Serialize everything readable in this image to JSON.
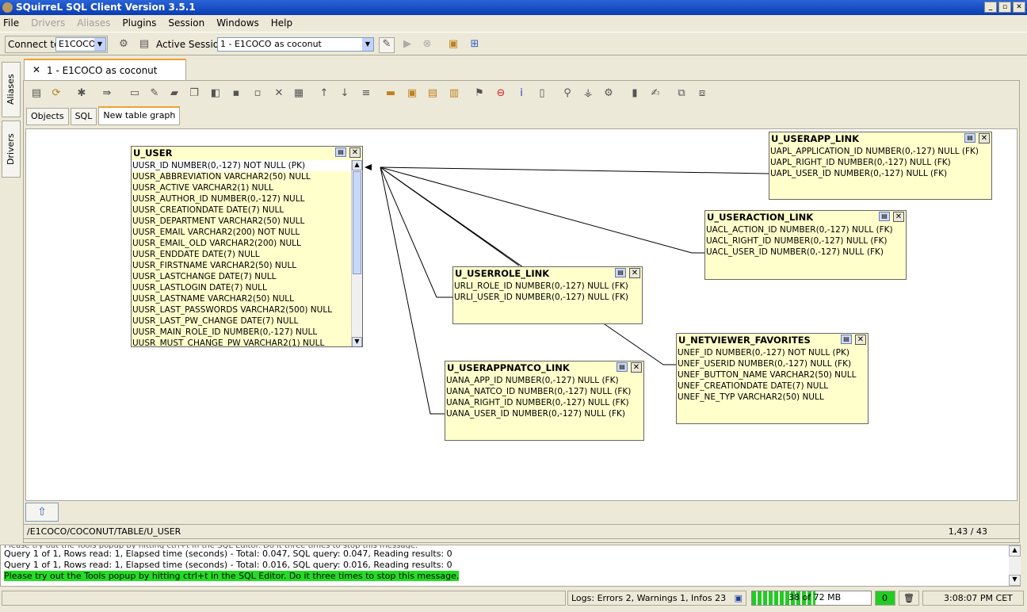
{
  "window": {
    "title": "SQuirreL SQL Client Version 3.5.1"
  },
  "menu": [
    "File",
    "Drivers",
    "Aliases",
    "Plugins",
    "Session",
    "Windows",
    "Help"
  ],
  "menu_disabled": [
    "Drivers",
    "Aliases"
  ],
  "toolbar": {
    "connect_label": "Connect to:",
    "connect_value": "E1COCO",
    "active_session_label": "Active Session:",
    "active_session_value": "1 - E1COCO as coconut"
  },
  "side_tabs": [
    "Aliases",
    "Drivers"
  ],
  "session_tab": {
    "label": "1 - E1COCO as coconut"
  },
  "sub_tabs": [
    "Objects",
    "SQL",
    "New table graph"
  ],
  "graph": {
    "tables": [
      {
        "name": "U_USER",
        "columns": [
          "UUSR_ID  NUMBER(0,-127) NOT NULL (PK)",
          "UUSR_ABBREVIATION  VARCHAR2(50) NULL",
          "UUSR_ACTIVE  VARCHAR2(1) NULL",
          "UUSR_AUTHOR_ID  NUMBER(0,-127) NULL",
          "UUSR_CREATIONDATE  DATE(7) NULL",
          "UUSR_DEPARTMENT  VARCHAR2(50) NULL",
          "UUSR_EMAIL  VARCHAR2(200) NOT NULL",
          "UUSR_EMAIL_OLD  VARCHAR2(200) NULL",
          "UUSR_ENDDATE  DATE(7) NULL",
          "UUSR_FIRSTNAME  VARCHAR2(50) NULL",
          "UUSR_LASTCHANGE  DATE(7) NULL",
          "UUSR_LASTLOGIN  DATE(7) NULL",
          "UUSR_LASTNAME  VARCHAR2(50) NULL",
          "UUSR_LAST_PASSWORDS  VARCHAR2(500) NULL",
          "UUSR_LAST_PW_CHANGE  DATE(7) NULL",
          "UUSR_MAIN_ROLE_ID  NUMBER(0,-127) NULL",
          "UUSR_MUST_CHANGE_PW  VARCHAR2(1) NULL"
        ]
      },
      {
        "name": "U_USERAPP_LINK",
        "columns": [
          "UAPL_APPLICATION_ID  NUMBER(0,-127) NULL (FK)",
          "UAPL_RIGHT_ID  NUMBER(0,-127) NULL (FK)",
          "UAPL_USER_ID  NUMBER(0,-127) NULL (FK)"
        ]
      },
      {
        "name": "U_USERACTION_LINK",
        "columns": [
          "UACL_ACTION_ID  NUMBER(0,-127) NULL (FK)",
          "UACL_RIGHT_ID  NUMBER(0,-127) NULL (FK)",
          "UACL_USER_ID  NUMBER(0,-127) NULL (FK)"
        ]
      },
      {
        "name": "U_USERROLE_LINK",
        "columns": [
          "URLI_ROLE_ID  NUMBER(0,-127) NULL (FK)",
          "URLI_USER_ID  NUMBER(0,-127) NULL (FK)"
        ]
      },
      {
        "name": "U_NETVIEWER_FAVORITES",
        "columns": [
          "UNEF_ID  NUMBER(0,-127) NOT NULL (PK)",
          "UNEF_USERID  NUMBER(0,-127) NULL (FK)",
          "UNEF_BUTTON_NAME  VARCHAR2(50) NULL",
          "UNEF_CREATIONDATE  DATE(7) NULL",
          "UNEF_NE_TYP  VARCHAR2(50) NULL"
        ]
      },
      {
        "name": "U_USERAPPNATCO_LINK",
        "columns": [
          "UANA_APP_ID  NUMBER(0,-127) NULL (FK)",
          "UANA_NATCO_ID  NUMBER(0,-127) NULL (FK)",
          "UANA_RIGHT_ID  NUMBER(0,-127) NULL (FK)",
          "UANA_USER_ID  NUMBER(0,-127) NULL (FK)"
        ]
      }
    ]
  },
  "path_bar": {
    "path": "/E1COCO/COCONUT/TABLE/U_USER",
    "position": "1,43 / 43"
  },
  "log": {
    "lines": [
      "Please try out the Tools popup by hitting ctrl+t in the SQL Editor. Do it three times to stop this message.",
      "Query 1 of 1, Rows read: 1, Elapsed time (seconds) - Total: 0.047, SQL query: 0.047, Reading results: 0",
      "Query 1 of 1, Rows read: 1, Elapsed time (seconds) - Total: 0.016, SQL query: 0.016, Reading results: 0"
    ],
    "highlight": "Please try out the Tools popup by hitting ctrl+t in the SQL Editor. Do it three times to stop this message."
  },
  "status": {
    "logs": "Logs: Errors 2, Warnings 1, Infos 23",
    "memory": "38 of 72 MB",
    "memory_fraction": 0.53,
    "counter": "0",
    "time": "3:08:07 PM CET"
  }
}
